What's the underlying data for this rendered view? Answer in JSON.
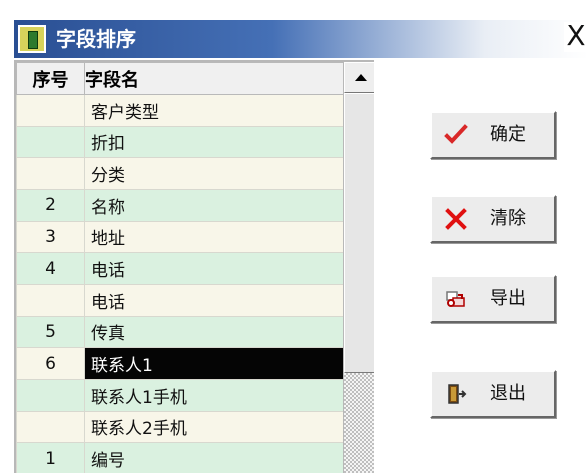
{
  "window": {
    "title": "字段排序",
    "close_label": "X"
  },
  "grid": {
    "headers": {
      "seq": "序号",
      "field": "字段名"
    },
    "rows": [
      {
        "seq": "",
        "field": "客户类型",
        "tone": "light",
        "selected": false
      },
      {
        "seq": "",
        "field": "折扣",
        "tone": "green",
        "selected": false
      },
      {
        "seq": "",
        "field": "分类",
        "tone": "light",
        "selected": false
      },
      {
        "seq": "2",
        "field": "名称",
        "tone": "green",
        "selected": false
      },
      {
        "seq": "3",
        "field": "地址",
        "tone": "light",
        "selected": false
      },
      {
        "seq": "4",
        "field": "电话",
        "tone": "green",
        "selected": false
      },
      {
        "seq": "",
        "field": "电话",
        "tone": "light",
        "selected": false
      },
      {
        "seq": "5",
        "field": "传真",
        "tone": "green",
        "selected": false
      },
      {
        "seq": "6",
        "field": "联系人1",
        "tone": "light",
        "selected": true
      },
      {
        "seq": "",
        "field": "联系人1手机",
        "tone": "green",
        "selected": false
      },
      {
        "seq": "",
        "field": "联系人2手机",
        "tone": "light",
        "selected": false
      },
      {
        "seq": "1",
        "field": "编号",
        "tone": "green",
        "selected": false
      }
    ]
  },
  "buttons": {
    "confirm": {
      "label": "确定",
      "icon": "check-icon"
    },
    "clear": {
      "label": "清除",
      "icon": "clear-x-icon"
    },
    "export": {
      "label": "导出",
      "icon": "export-icon"
    },
    "exit": {
      "label": "退出",
      "icon": "exit-door-icon"
    }
  },
  "colors": {
    "title_start": "#2a4f93",
    "title_end": "#ffffff",
    "row_light": "#f8f6e9",
    "row_green": "#daf1e0",
    "selection": "#050505",
    "check_red": "#d92828",
    "clear_red": "#e01010"
  }
}
